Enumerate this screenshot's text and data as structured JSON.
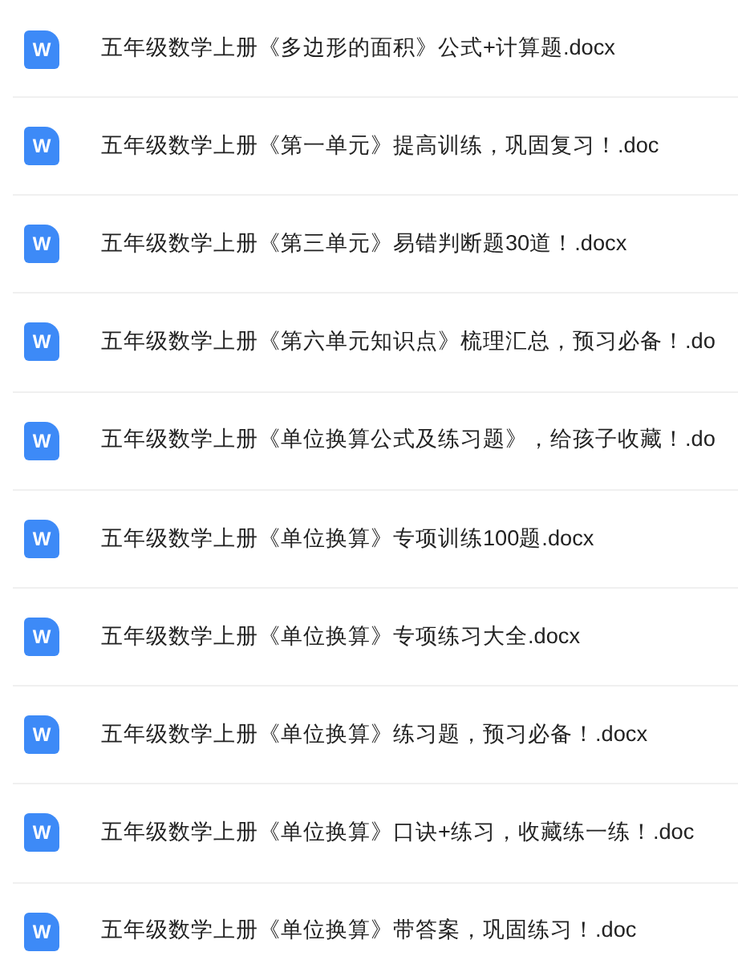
{
  "files": [
    {
      "icon_label": "W",
      "name": "五年级数学上册《多边形的面积》公式+计算题.docx"
    },
    {
      "icon_label": "W",
      "name": "五年级数学上册《第一单元》提高训练，巩固复习！.doc"
    },
    {
      "icon_label": "W",
      "name": "五年级数学上册《第三单元》易错判断题30道！.docx"
    },
    {
      "icon_label": "W",
      "name": "五年级数学上册《第六单元知识点》梳理汇总，预习必备！.do"
    },
    {
      "icon_label": "W",
      "name": "五年级数学上册《单位换算公式及练习题》，给孩子收藏！.do"
    },
    {
      "icon_label": "W",
      "name": "五年级数学上册《单位换算》专项训练100题.docx"
    },
    {
      "icon_label": "W",
      "name": "五年级数学上册《单位换算》专项练习大全.docx"
    },
    {
      "icon_label": "W",
      "name": "五年级数学上册《单位换算》练习题，预习必备！.docx"
    },
    {
      "icon_label": "W",
      "name": "五年级数学上册《单位换算》口诀+练习，收藏练一练！.doc"
    },
    {
      "icon_label": "W",
      "name": "五年级数学上册《单位换算》带答案，巩固练习！.doc"
    }
  ]
}
